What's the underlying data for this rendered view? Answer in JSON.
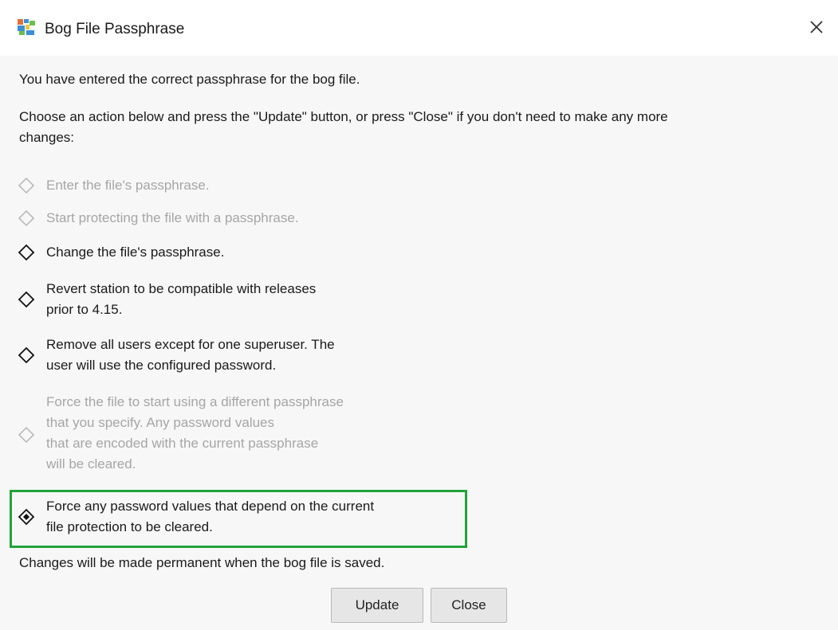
{
  "window": {
    "title": "Bog File Passphrase"
  },
  "messages": {
    "intro": "You have entered the correct passphrase for the bog file.",
    "instruction_line1": "Choose an action below and press the \"Update\" button, or press \"Close\" if you don't need to make any more",
    "instruction_line2": "changes:",
    "footer": "Changes will be made permanent when the bog file is saved."
  },
  "options": [
    {
      "lines": [
        "Enter the file's passphrase."
      ],
      "enabled": false,
      "selected": false
    },
    {
      "lines": [
        "Start protecting the file with a passphrase."
      ],
      "enabled": false,
      "selected": false
    },
    {
      "lines": [
        "Change the file's passphrase."
      ],
      "enabled": true,
      "selected": false
    },
    {
      "lines": [
        "Revert station to be compatible with releases",
        "prior to 4.15."
      ],
      "enabled": true,
      "selected": false
    },
    {
      "lines": [
        "Remove all users except for one superuser. The",
        "user will use the configured password."
      ],
      "enabled": true,
      "selected": false
    },
    {
      "lines": [
        "Force the file to start using a different passphrase",
        "that you specify. Any password values",
        "that are encoded with the current passphrase",
        "will be cleared."
      ],
      "enabled": false,
      "selected": false
    },
    {
      "lines": [
        "Force any password values that depend on the current",
        "file protection to be cleared."
      ],
      "enabled": true,
      "selected": true
    }
  ],
  "buttons": {
    "update_label": "Update",
    "close_label": "Close"
  },
  "colors": {
    "highlight_border": "#21a33a",
    "disabled_text": "#a6a6a6",
    "text": "#1a1a1a"
  },
  "icons": {
    "app": "niagara-app-icon",
    "close": "close-icon",
    "radio": "diamond-radio-icon"
  }
}
